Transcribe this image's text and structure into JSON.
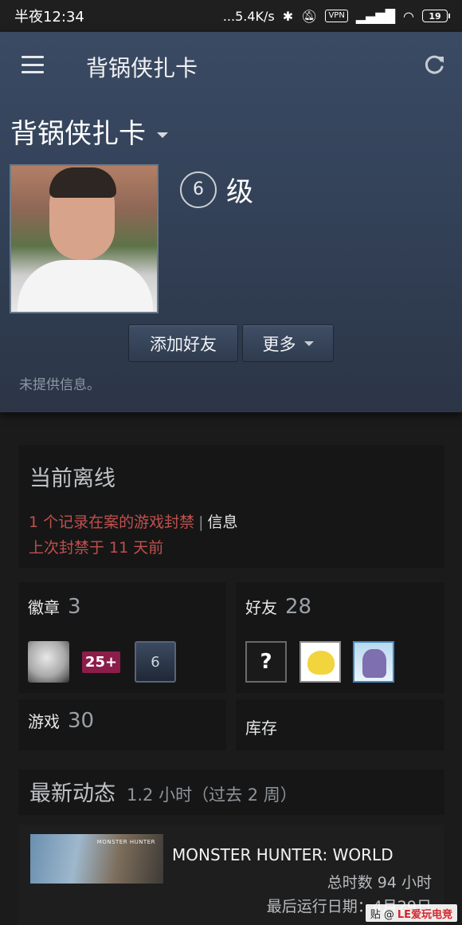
{
  "statusbar": {
    "time": "半夜12:34",
    "speed": "...5.4K/s",
    "vpn": "VPN",
    "battery": "19"
  },
  "appbar": {
    "title": "背锅侠扎卡"
  },
  "profile": {
    "persona_name": "背锅侠扎卡",
    "level_number": "6",
    "level_label": "级",
    "add_friend": "添加好友",
    "more": "更多",
    "no_info": "未提供信息。"
  },
  "status": {
    "title": "当前离线",
    "ban_record": "1 个记录在案的游戏封禁",
    "separator": "|",
    "info_link": "信息",
    "last_ban": "上次封禁于 11 天前"
  },
  "stats": {
    "badges_label": "徽章",
    "badges_count": "3",
    "badge_items": [
      "",
      "25+",
      "6"
    ],
    "friends_label": "好友",
    "friends_count": "28",
    "friend_q": "?",
    "games_label": "游戏",
    "games_count": "30",
    "inventory_label": "库存"
  },
  "activity": {
    "title": "最新动态",
    "subtitle": "1.2 小时（过去 2 周）"
  },
  "recent_game": {
    "art_text": "MONSTER HUNTER",
    "name": "MONSTER HUNTER: WORLD",
    "total_hours": "总时数 94 小时",
    "last_played": "最后运行日期：4月29日"
  },
  "watermark": {
    "left": "贴 @",
    "brand": "LE爱玩电竞"
  },
  "colors": {
    "ban_red": "#c0504d",
    "header_top": "#3a4a63"
  }
}
